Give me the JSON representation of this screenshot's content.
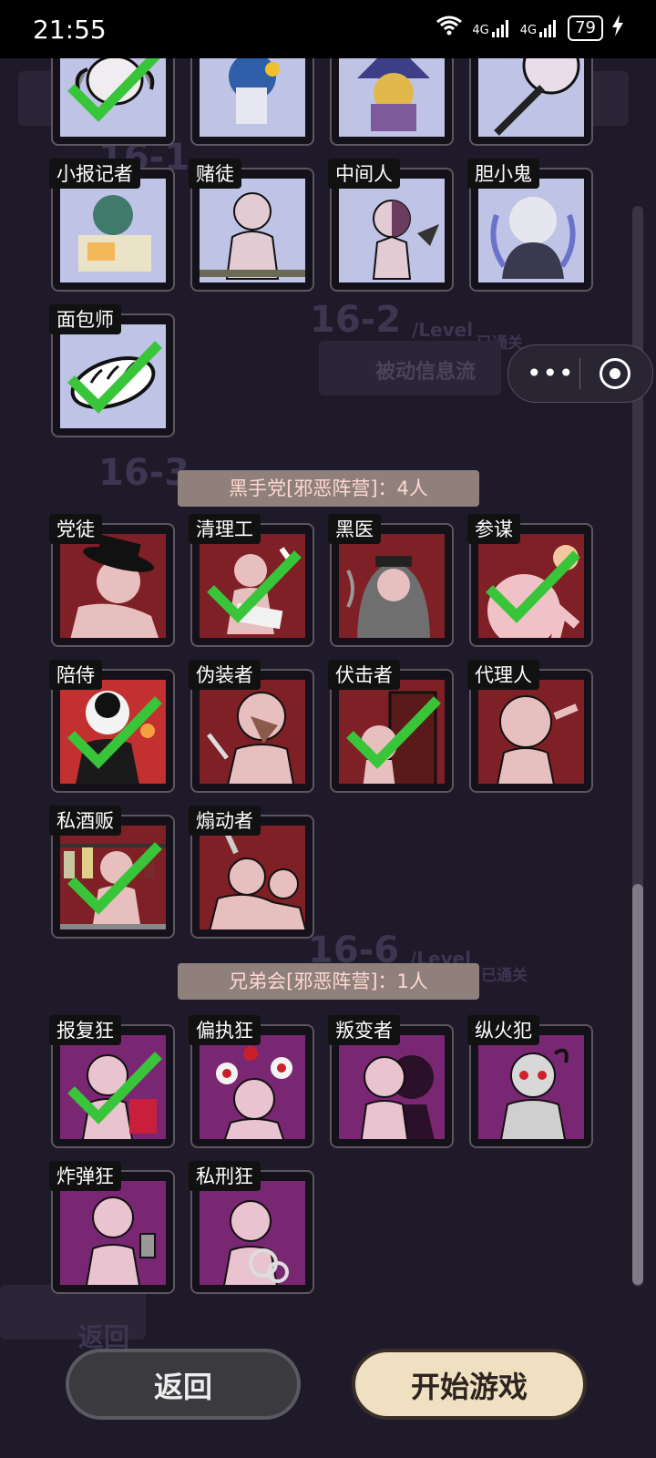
{
  "status_bar": {
    "time": "21:55",
    "network": "4G",
    "battery": "79"
  },
  "background": {
    "levels": [
      "16-1",
      "16-2",
      "16-3",
      "16-6"
    ],
    "level_unit": "/Level",
    "cleared_badge": "已通关",
    "level_name": "被动信息流",
    "back_text": "返回"
  },
  "sections": [
    {
      "header": "",
      "color": "blue",
      "roles": [
        {
          "name": "",
          "checked": true,
          "icon": "goat-figure"
        },
        {
          "name": "",
          "checked": false,
          "icon": "blue-girl"
        },
        {
          "name": "",
          "checked": false,
          "icon": "witch-figure"
        },
        {
          "name": "",
          "checked": false,
          "icon": "gun-figure"
        },
        {
          "name": "小报记者",
          "checked": false,
          "icon": "reporter"
        },
        {
          "name": "赌徒",
          "checked": false,
          "icon": "gambler"
        },
        {
          "name": "中间人",
          "checked": false,
          "icon": "middleman"
        },
        {
          "name": "胆小鬼",
          "checked": false,
          "icon": "coward"
        },
        {
          "name": "面包师",
          "checked": true,
          "icon": "bread"
        }
      ]
    },
    {
      "header": "黑手党[邪恶阵营]：4人",
      "color": "red",
      "roles": [
        {
          "name": "党徒",
          "checked": false,
          "icon": "fedora-figure"
        },
        {
          "name": "清理工",
          "checked": true,
          "icon": "cleaner"
        },
        {
          "name": "黑医",
          "checked": false,
          "icon": "dark-doctor"
        },
        {
          "name": "参谋",
          "checked": true,
          "icon": "advisor"
        },
        {
          "name": "陪侍",
          "checked": true,
          "icon": "escort"
        },
        {
          "name": "伪装者",
          "checked": false,
          "icon": "disguiser"
        },
        {
          "name": "伏击者",
          "checked": true,
          "icon": "ambusher"
        },
        {
          "name": "代理人",
          "checked": false,
          "icon": "agent"
        },
        {
          "name": "私酒贩",
          "checked": true,
          "icon": "bootlegger"
        },
        {
          "name": "煽动者",
          "checked": false,
          "icon": "instigator"
        }
      ]
    },
    {
      "header": "兄弟会[邪恶阵营]：1人",
      "color": "purple",
      "roles": [
        {
          "name": "报复狂",
          "checked": true,
          "icon": "avenger"
        },
        {
          "name": "偏执狂",
          "checked": false,
          "icon": "paranoid"
        },
        {
          "name": "叛变者",
          "checked": false,
          "icon": "traitor"
        },
        {
          "name": "纵火犯",
          "checked": false,
          "icon": "arsonist"
        },
        {
          "name": "炸弹狂",
          "checked": false,
          "icon": "bomber"
        },
        {
          "name": "私刑狂",
          "checked": false,
          "icon": "lyncher"
        }
      ]
    }
  ],
  "buttons": {
    "back": "返回",
    "start": "开始游戏"
  },
  "colors": {
    "blue_panel": "#bfc3e6",
    "red_panel": "#7e2025",
    "purple_panel": "#7a2773",
    "check": "#39c539",
    "header_bg": "#8f807c",
    "header_text": "#ffd7d0"
  }
}
